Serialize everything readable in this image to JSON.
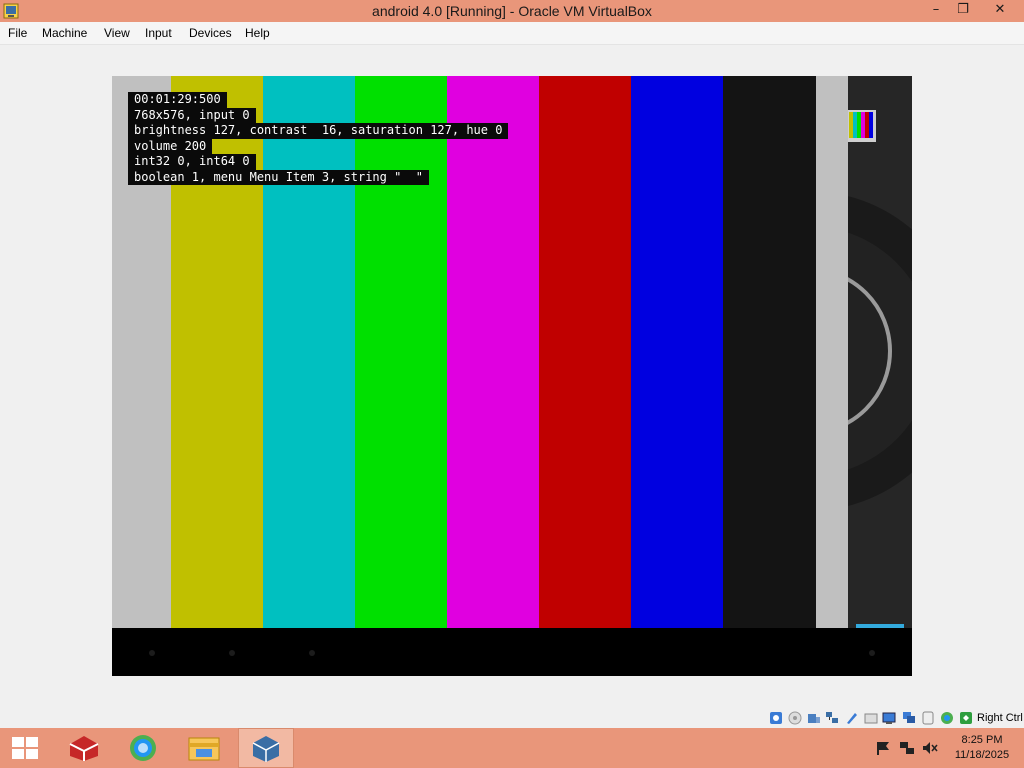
{
  "window": {
    "title": "android 4.0 [Running] - Oracle VM VirtualBox",
    "controls": {
      "minimize": "–",
      "restore": "❐",
      "close": "✕"
    }
  },
  "menu": {
    "items": [
      "File",
      "Machine",
      "View",
      "Input",
      "Devices",
      "Help"
    ]
  },
  "vm": {
    "bar_colors": [
      "#c0c0c0",
      "#c0c000",
      "#00c0c0",
      "#00e000",
      "#e000e0",
      "#c00000",
      "#0000e0",
      "#141414",
      "#c0c0c0"
    ],
    "osd": [
      "00:01:29:500",
      "768x576, input 0",
      "brightness 127, contrast  16, saturation 127, hue 0",
      "volume 200",
      "int32 0, int64 0",
      "boolean 1, menu Menu Item 3, string \"  \""
    ]
  },
  "statusbar": {
    "icons": [
      "hard-disk-icon",
      "optical-drive-icon",
      "audio-icon",
      "network-icon",
      "usb-icon",
      "shared-folders-icon",
      "display-icon",
      "video-capture-icon",
      "mouse-integration-icon",
      "cpu-icon",
      "host-key-arrow-icon"
    ],
    "host_key": "Right Ctrl"
  },
  "taskbar": {
    "apps": [
      "start-button",
      "app-red-box-icon",
      "browser-icon",
      "file-explorer-icon",
      "virtualbox-icon"
    ],
    "clock": {
      "time": "8:25 PM",
      "date": "11/18/2025"
    }
  }
}
